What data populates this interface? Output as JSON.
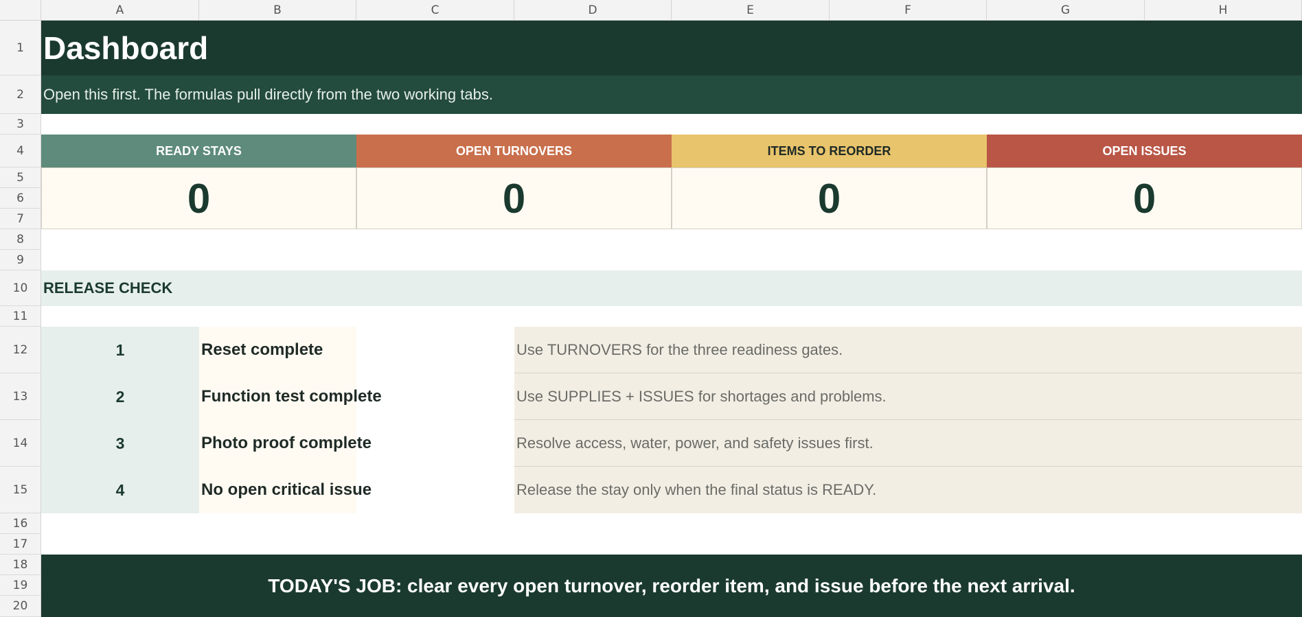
{
  "columns": [
    "A",
    "B",
    "C",
    "D",
    "E",
    "F",
    "G",
    "H"
  ],
  "rows": [
    "1",
    "2",
    "3",
    "4",
    "5",
    "6",
    "7",
    "8",
    "9",
    "10",
    "11",
    "12",
    "13",
    "14",
    "15",
    "16",
    "17",
    "18",
    "19",
    "20"
  ],
  "title": "Dashboard",
  "subtitle": "Open this first. The formulas pull directly from the two working tabs.",
  "kpis": [
    {
      "label": "READY STAYS",
      "value": "0",
      "color": "#5e8b7b"
    },
    {
      "label": "OPEN TURNOVERS",
      "value": "0",
      "color": "#c96f4c"
    },
    {
      "label": "ITEMS TO REORDER",
      "value": "0",
      "color": "#e8c46c"
    },
    {
      "label": "OPEN ISSUES",
      "value": "0",
      "color": "#b95646"
    }
  ],
  "section_title": "RELEASE CHECK",
  "checks": [
    {
      "num": "1",
      "step": "Reset complete",
      "note": "Use TURNOVERS for the three readiness gates."
    },
    {
      "num": "2",
      "step": "Function test complete",
      "note": "Use SUPPLIES + ISSUES for shortages and problems."
    },
    {
      "num": "3",
      "step": "Photo proof complete",
      "note": "Resolve access, water, power, and safety issues first."
    },
    {
      "num": "4",
      "step": "No open critical issue",
      "note": "Release the stay only when the final status is READY."
    }
  ],
  "footer": "TODAY'S JOB: clear every open turnover, reorder item, and issue before the next arrival.",
  "colors": {
    "dark_green": "#1b3a2f",
    "mid_green": "#234b3e",
    "light_green": "#e7efec",
    "cream": "#fffbf3",
    "beige": "#f2eee4"
  }
}
